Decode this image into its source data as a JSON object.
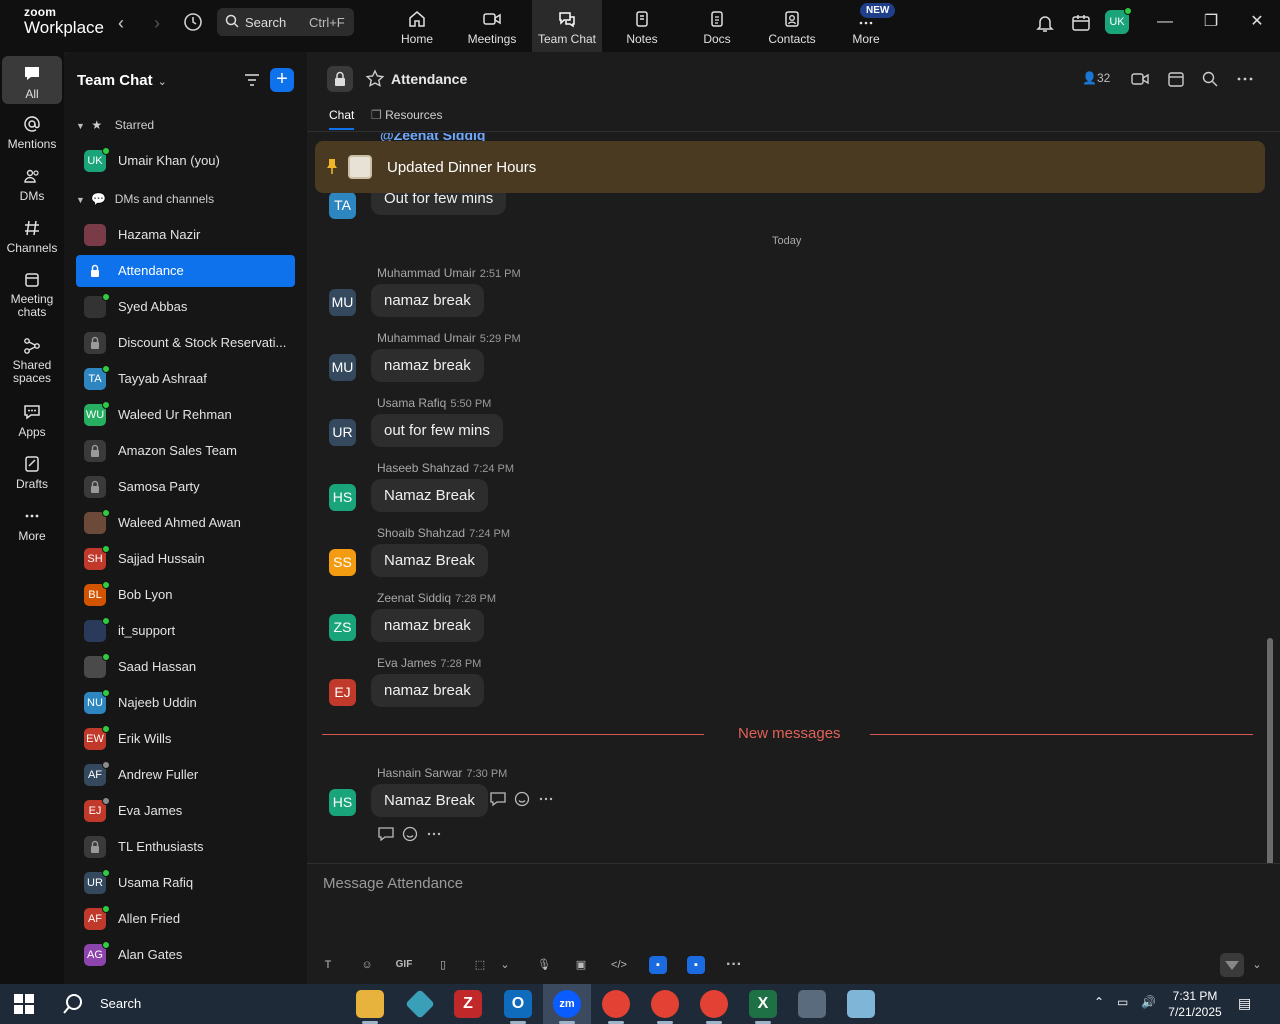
{
  "brand": {
    "line1": "zoom",
    "line2": "Workplace"
  },
  "search": {
    "label": "Search",
    "shortcut": "Ctrl+F"
  },
  "top_tabs": [
    {
      "label": "Home",
      "icon": "home-icon"
    },
    {
      "label": "Meetings",
      "icon": "video-icon"
    },
    {
      "label": "Team Chat",
      "icon": "chat-icon"
    },
    {
      "label": "Notes",
      "icon": "notes-icon"
    },
    {
      "label": "Docs",
      "icon": "docs-icon"
    },
    {
      "label": "Contacts",
      "icon": "contacts-icon"
    },
    {
      "label": "More",
      "icon": "more-icon"
    }
  ],
  "new_badge": "NEW",
  "user_initials": "UK",
  "rail": [
    {
      "label": "All",
      "icon": "chat-bubble-icon"
    },
    {
      "label": "Mentions",
      "icon": "at-icon"
    },
    {
      "label": "DMs",
      "icon": "people-icon"
    },
    {
      "label": "Channels",
      "icon": "hash-icon"
    },
    {
      "label": "Meeting chats",
      "icon": "calendar-icon"
    },
    {
      "label": "Shared spaces",
      "icon": "share-icon"
    },
    {
      "label": "Apps",
      "icon": "apps-icon"
    },
    {
      "label": "Drafts",
      "icon": "drafts-icon"
    },
    {
      "label": "More",
      "icon": "more-icon"
    }
  ],
  "sidebar": {
    "title": "Team Chat",
    "starred_label": "Starred",
    "starred_item": {
      "initials": "UK",
      "name": "Umair Khan (you)",
      "color": "#1aa47a"
    },
    "dms_label": "DMs and channels",
    "items": [
      {
        "type": "img",
        "name": "Hazama Nazir",
        "color": "#7a3b49"
      },
      {
        "type": "lock",
        "name": "Attendance",
        "active": true
      },
      {
        "type": "img",
        "name": "Syed Abbas",
        "color": "#333333",
        "status": "online"
      },
      {
        "type": "lock",
        "name": "Discount & Stock Reservati..."
      },
      {
        "type": "av",
        "initials": "TA",
        "name": "Tayyab Ashraaf",
        "color": "#2e86c1",
        "status": "online"
      },
      {
        "type": "av",
        "initials": "WU",
        "name": "Waleed Ur Rehman",
        "color": "#27ae60",
        "status": "online"
      },
      {
        "type": "lock",
        "name": "Amazon Sales Team"
      },
      {
        "type": "lock",
        "name": "Samosa Party"
      },
      {
        "type": "img",
        "name": "Waleed Ahmed Awan",
        "color": "#6b4a3a",
        "status": "online"
      },
      {
        "type": "av",
        "initials": "SH",
        "name": "Sajjad Hussain",
        "color": "#c0392b",
        "status": "online"
      },
      {
        "type": "av",
        "initials": "BL",
        "name": "Bob Lyon",
        "color": "#d35400",
        "status": "online"
      },
      {
        "type": "img",
        "name": "it_support",
        "color": "#2a3a5a",
        "status": "online"
      },
      {
        "type": "img",
        "name": "Saad Hassan",
        "color": "#4a4a4a",
        "status": "online"
      },
      {
        "type": "av",
        "initials": "NU",
        "name": "Najeeb Uddin",
        "color": "#2e86c1",
        "status": "online"
      },
      {
        "type": "av",
        "initials": "EW",
        "name": "Erik Wills",
        "color": "#c0392b",
        "status": "online"
      },
      {
        "type": "av",
        "initials": "AF",
        "name": "Andrew Fuller",
        "color": "#34495e",
        "status": "away"
      },
      {
        "type": "av",
        "initials": "EJ",
        "name": "Eva James",
        "color": "#c0392b",
        "status": "away"
      },
      {
        "type": "lock",
        "name": "TL Enthusiasts"
      },
      {
        "type": "av",
        "initials": "UR",
        "name": "Usama Rafiq",
        "color": "#34495e",
        "status": "online"
      },
      {
        "type": "av",
        "initials": "AF",
        "name": "Allen Fried",
        "color": "#c0392b",
        "status": "online"
      },
      {
        "type": "av",
        "initials": "AG",
        "name": "Alan Gates",
        "color": "#8e44ad",
        "status": "online"
      }
    ]
  },
  "channel": {
    "name": "Attendance",
    "members": "32",
    "tabs": [
      "Chat",
      "Resources"
    ],
    "pinned": "Updated Dinner Hours",
    "cut_text": "@Zeenat Siddiq",
    "earlier": {
      "initials": "TA",
      "color": "#2e86c1",
      "text": "Out for few mins"
    },
    "today_label": "Today",
    "new_messages_label": "New messages",
    "composer_placeholder": "Message Attendance"
  },
  "messages": [
    {
      "initials": "MU",
      "color": "#34495e",
      "author": "Muhammad Umair",
      "time": "2:51 PM",
      "text": "namaz break"
    },
    {
      "initials": "MU",
      "color": "#34495e",
      "author": "Muhammad Umair",
      "time": "5:29 PM",
      "text": "namaz break"
    },
    {
      "initials": "UR",
      "color": "#34495e",
      "author": "Usama Rafiq",
      "time": "5:50 PM",
      "text": "out for few mins"
    },
    {
      "initials": "HS",
      "color": "#1aa47a",
      "author": "Haseeb Shahzad",
      "time": "7:24 PM",
      "text": "Namaz Break"
    },
    {
      "initials": "SS",
      "color": "#f39c12",
      "author": "Shoaib Shahzad",
      "time": "7:24 PM",
      "text": "Namaz Break"
    },
    {
      "initials": "ZS",
      "color": "#1aa47a",
      "author": "Zeenat Siddiq",
      "time": "7:28 PM",
      "text": "namaz break"
    },
    {
      "initials": "EJ",
      "color": "#c0392b",
      "author": "Eva James",
      "time": "7:28 PM",
      "text": "namaz break"
    }
  ],
  "new_message": {
    "initials": "HS",
    "color": "#1aa47a",
    "author": "Hasnain Sarwar",
    "time": "7:30 PM",
    "text": "Namaz Break"
  },
  "composer_tools": [
    "text-format-icon",
    "emoji-icon",
    "GIF",
    "file-icon",
    "screenshot-icon",
    "chevron-down-icon",
    "mic-icon",
    "video-msg-icon",
    "code-icon",
    "app1-icon",
    "app2-icon",
    "more-icon"
  ],
  "taskbar": {
    "search_label": "Search",
    "time": "7:31 PM",
    "date": "7/21/2025"
  }
}
